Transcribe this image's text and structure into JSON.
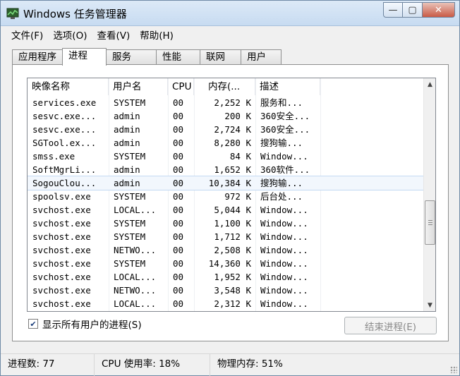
{
  "window": {
    "title": "Windows 任务管理器",
    "min_glyph": "—",
    "max_glyph": "▢",
    "close_glyph": "✕"
  },
  "menu": [
    "文件(F)",
    "选项(O)",
    "查看(V)",
    "帮助(H)"
  ],
  "tabs": [
    {
      "label": "应用程序",
      "active": false
    },
    {
      "label": "进程",
      "active": true
    },
    {
      "label": "服务",
      "active": false
    },
    {
      "label": "性能",
      "active": false
    },
    {
      "label": "联网",
      "active": false
    },
    {
      "label": "用户",
      "active": false
    }
  ],
  "table": {
    "columns": [
      "映像名称",
      "用户名",
      "CPU",
      "内存(...",
      "描述"
    ],
    "rows": [
      [
        "services.exe",
        "SYSTEM",
        "00",
        "2,252 K",
        "服务和..."
      ],
      [
        "sesvc.exe...",
        "admin",
        "00",
        "200 K",
        "360安全..."
      ],
      [
        "sesvc.exe...",
        "admin",
        "00",
        "2,724 K",
        "360安全..."
      ],
      [
        "SGTool.ex...",
        "admin",
        "00",
        "8,280 K",
        "搜狗输..."
      ],
      [
        "smss.exe",
        "SYSTEM",
        "00",
        "84 K",
        "Window..."
      ],
      [
        "SoftMgrLi...",
        "admin",
        "00",
        "1,652 K",
        "360软件..."
      ],
      [
        "SogouClou...",
        "admin",
        "00",
        "10,384 K",
        "搜狗输..."
      ],
      [
        "spoolsv.exe",
        "SYSTEM",
        "00",
        "972 K",
        "后台处..."
      ],
      [
        "svchost.exe",
        "LOCAL...",
        "00",
        "5,044 K",
        "Window..."
      ],
      [
        "svchost.exe",
        "SYSTEM",
        "00",
        "1,100 K",
        "Window..."
      ],
      [
        "svchost.exe",
        "SYSTEM",
        "00",
        "1,712 K",
        "Window..."
      ],
      [
        "svchost.exe",
        "NETWO...",
        "00",
        "2,508 K",
        "Window..."
      ],
      [
        "svchost.exe",
        "SYSTEM",
        "00",
        "14,360 K",
        "Window..."
      ],
      [
        "svchost.exe",
        "LOCAL...",
        "00",
        "1,952 K",
        "Window..."
      ],
      [
        "svchost.exe",
        "NETWO...",
        "00",
        "3,548 K",
        "Window..."
      ],
      [
        "svchost.exe",
        "LOCAL...",
        "00",
        "2,312 K",
        "Window..."
      ]
    ],
    "selected_row": 6
  },
  "show_all_users": {
    "label": "显示所有用户的进程(S)",
    "checked": true,
    "mark": "✔"
  },
  "end_process_button": "结束进程(E)",
  "status": {
    "processes": "进程数: 77",
    "cpu": "CPU 使用率: 18%",
    "memory": "物理内存: 51%"
  },
  "colors": {
    "selection": "#f2f7fd",
    "titlebar": "#dce9f7"
  }
}
